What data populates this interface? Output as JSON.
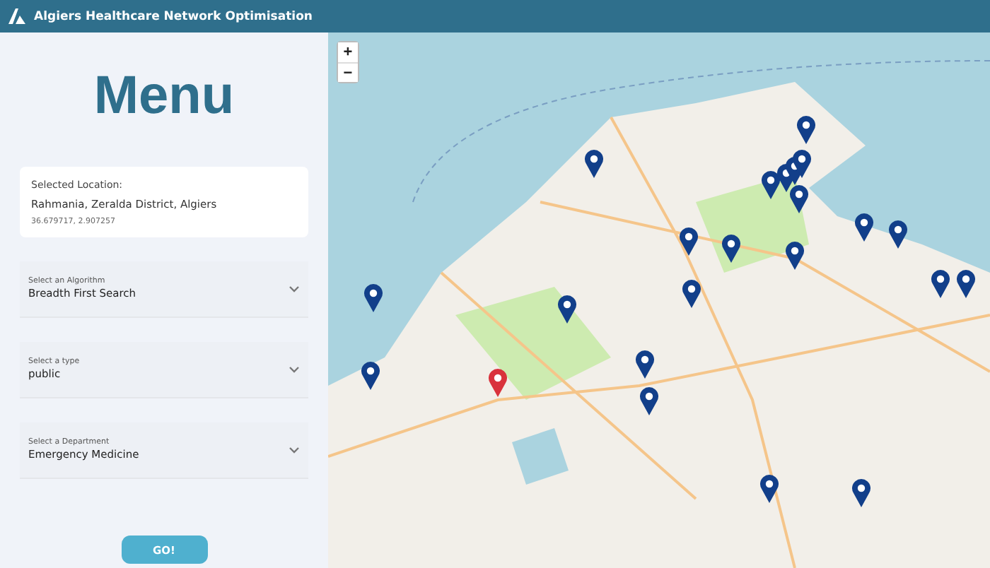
{
  "header": {
    "title": "Algiers Healthcare Network Optimisation"
  },
  "menu": {
    "title": "Menu",
    "location": {
      "label": "Selected Location:",
      "name": "Rahmania, Zeralda District, Algiers",
      "coords": "36.679717, 2.907257"
    },
    "selects": [
      {
        "label": "Select an Algorithm",
        "value": "Breadth First Search"
      },
      {
        "label": "Select a type",
        "value": "public"
      },
      {
        "label": "Select a Department",
        "value": "Emergency Medicine"
      }
    ],
    "button": "GO!"
  },
  "map": {
    "zoom_in": "+",
    "zoom_out": "−",
    "markers": [
      {
        "selected": false
      },
      {
        "selected": false
      },
      {
        "selected": false
      },
      {
        "selected": false
      },
      {
        "selected": false
      },
      {
        "selected": false
      },
      {
        "selected": false
      },
      {
        "selected": false
      },
      {
        "selected": false
      },
      {
        "selected": false
      },
      {
        "selected": false
      },
      {
        "selected": false
      },
      {
        "selected": false
      },
      {
        "selected": false
      },
      {
        "selected": false
      },
      {
        "selected": false
      },
      {
        "selected": false
      },
      {
        "selected": false
      },
      {
        "selected": false
      },
      {
        "selected": false
      },
      {
        "selected": false
      },
      {
        "selected": false
      },
      {
        "selected": true
      }
    ]
  }
}
